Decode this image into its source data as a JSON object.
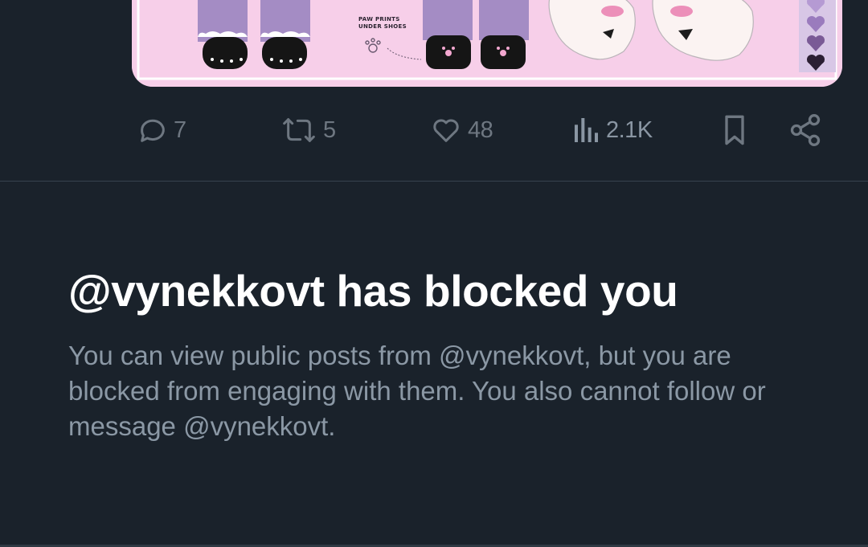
{
  "media": {
    "caption_line1": "PAW PRINTS",
    "caption_line2": "UNDER SHOES"
  },
  "actions": {
    "replies": "7",
    "reposts": "5",
    "likes": "48",
    "views": "2.1K",
    "icons": [
      "reply-icon",
      "repost-icon",
      "like-icon",
      "views-icon",
      "bookmark-icon",
      "share-icon"
    ]
  },
  "block_notice": {
    "title": "@vynekkovt has blocked you",
    "body": "You can view public posts from @vynekkovt, but you are blocked from engaging with them. You also cannot follow or message @vynekkovt."
  },
  "colors": {
    "background": "#1a222b",
    "muted_text": "#8b98a5",
    "icon": "#6e7781",
    "media_pink": "#f7cfe9",
    "heart_purple": "#7a5a96"
  }
}
